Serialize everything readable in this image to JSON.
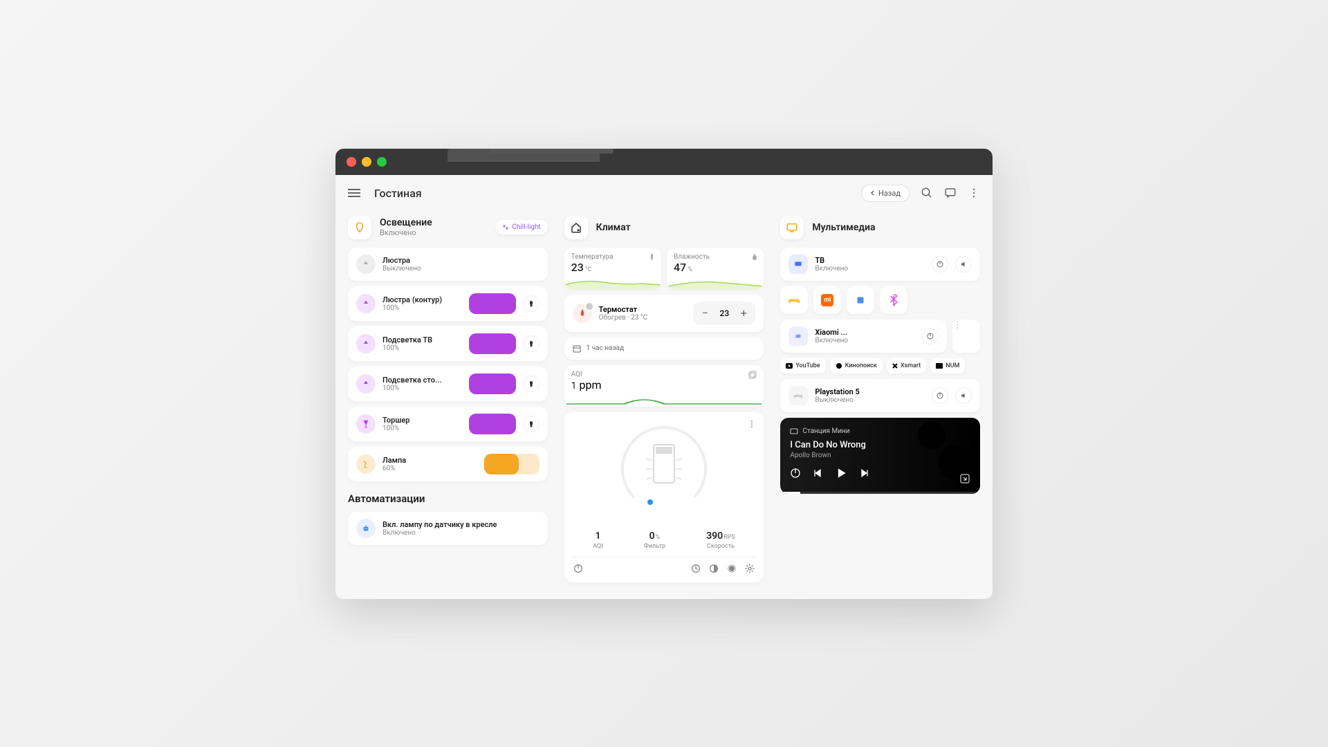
{
  "page_title": "Гостиная",
  "back": "Назад",
  "lighting": {
    "title": "Освещение",
    "status": "Включено",
    "chip": "Chill-light"
  },
  "lights": [
    {
      "name": "Люстра",
      "status": "Выключено",
      "on": false
    },
    {
      "name": "Люстра (контур)",
      "status": "100%",
      "on": true,
      "color": "purple"
    },
    {
      "name": "Подсветка ТВ",
      "status": "100%",
      "on": true,
      "color": "purple"
    },
    {
      "name": "Подсветка сто...",
      "status": "100%",
      "on": true,
      "color": "purple"
    },
    {
      "name": "Торшер",
      "status": "100%",
      "on": true,
      "color": "purple",
      "icon": "floor"
    },
    {
      "name": "Лампа",
      "status": "60%",
      "on": true,
      "color": "orange",
      "icon": "desk"
    }
  ],
  "automation": {
    "title": "Автоматизации",
    "items": [
      {
        "name": "Вкл. лампу по датчику в кресле",
        "status": "Включено"
      }
    ]
  },
  "climate": {
    "title": "Климат",
    "temp_lbl": "Температура",
    "temp_val": "23",
    "temp_unit": "°C",
    "hum_lbl": "Влажность",
    "hum_val": "47",
    "hum_unit": "%",
    "thermo_name": "Термостат",
    "thermo_status": "Обогрев · 23 °C",
    "thermo_val": "23",
    "schedule": "1 час назад",
    "aqi_lbl": "AQI",
    "aqi_val": "1",
    "aqi_unit": "ppm",
    "pur_aqi": "1",
    "pur_aqi_lbl": "AQI",
    "pur_filter": "0",
    "pur_filter_unit": "%",
    "pur_filter_lbl": "Фильтр",
    "pur_speed": "390",
    "pur_speed_unit": "RPS",
    "pur_speed_lbl": "Скорость"
  },
  "media": {
    "title": "Мультимедиа",
    "tv": {
      "name": "ТВ",
      "status": "Включено"
    },
    "xiaomi": {
      "name": "Xiaomi ...",
      "status": "Включено"
    },
    "svcs": [
      "YouTube",
      "Кинопоиск",
      "Xsmart",
      "NUM"
    ],
    "ps": {
      "name": "Playstation 5",
      "status": "Выключено"
    },
    "player": {
      "device": "Станция Мини",
      "track": "I Can Do No Wrong",
      "artist": "Apollo Brown"
    }
  }
}
